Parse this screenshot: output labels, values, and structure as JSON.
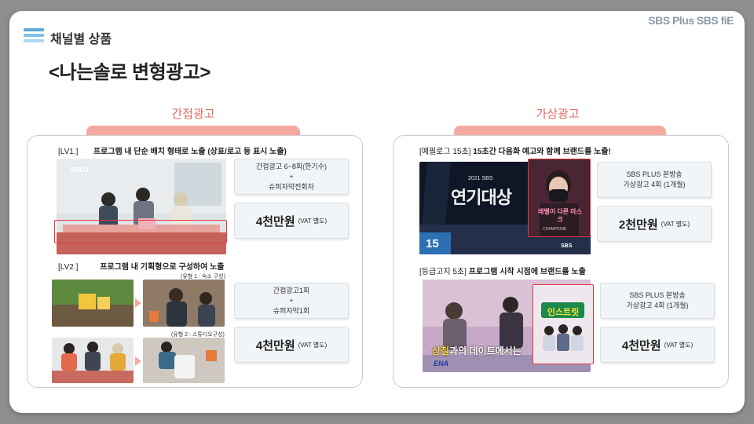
{
  "header": {
    "section_title": "채널별 상품",
    "logo_text": "SBS Plus SBS fiE",
    "main_title": "<나는솔로 변형광고>",
    "menu_colors": [
      "#5aa9d6",
      "#7cc3e6",
      "#a9d9ef"
    ]
  },
  "left": {
    "heading": "간접광고",
    "lv1": {
      "label_prefix": "[LV1.]",
      "label_text": "프로그램 내 단순 배치 형태로 노출 (상표/로고 등 표시 노출)",
      "photo_logo": "SOLO",
      "info_line1": "간접광고 6~8회(한기수)",
      "info_plus": "+",
      "info_line2": "슈퍼자막전회차",
      "price": "4천만원",
      "vat": "(VAT 별도)"
    },
    "lv2": {
      "label_prefix": "[LV2.]",
      "label_text": "프로그램 내 기획형으로 구성하여 노출",
      "tag1": "(유형 1 : 숙소 구성)",
      "tag2": "(유형 2 : 스튜디오구성)",
      "info_line1": "간접광고1회",
      "info_plus": "+",
      "info_line2": "슈퍼자막1회",
      "price": "4천만원",
      "vat": "(VAT 별도)"
    }
  },
  "right": {
    "heading": "가상광고",
    "item1": {
      "label_prefix": "[예필로그 15초]",
      "label_text": "15초간 다음화 예고와 함께 브랜드를 노출!",
      "screen_title": "연기대상",
      "screen_year": "2021 SBS",
      "screen_number": "15",
      "screen_brand": "SBS",
      "ad_text": "레벨이 다른 마스크",
      "ad_sub": "CHAMPIONE",
      "info_line1": "SBS PLUS 본방송",
      "info_line2": "가상광고 4회 (1개월)",
      "price": "2천만원",
      "vat": "(VAT 별도)"
    },
    "item2": {
      "label_prefix": "[등급고지 5초]",
      "label_text": "프로그램 시작 시점에 브랜드를 노출",
      "screen_caption": "과의 데이트에서는",
      "screen_caption_hl": "상철",
      "screen_brand": "ENA",
      "ad_text": "인스트릿",
      "info_line1": "SBS PLUS 본방송",
      "info_line2": "가상광고 4회 (1개월)",
      "price": "4천만원",
      "vat": "(VAT 별도)"
    }
  }
}
